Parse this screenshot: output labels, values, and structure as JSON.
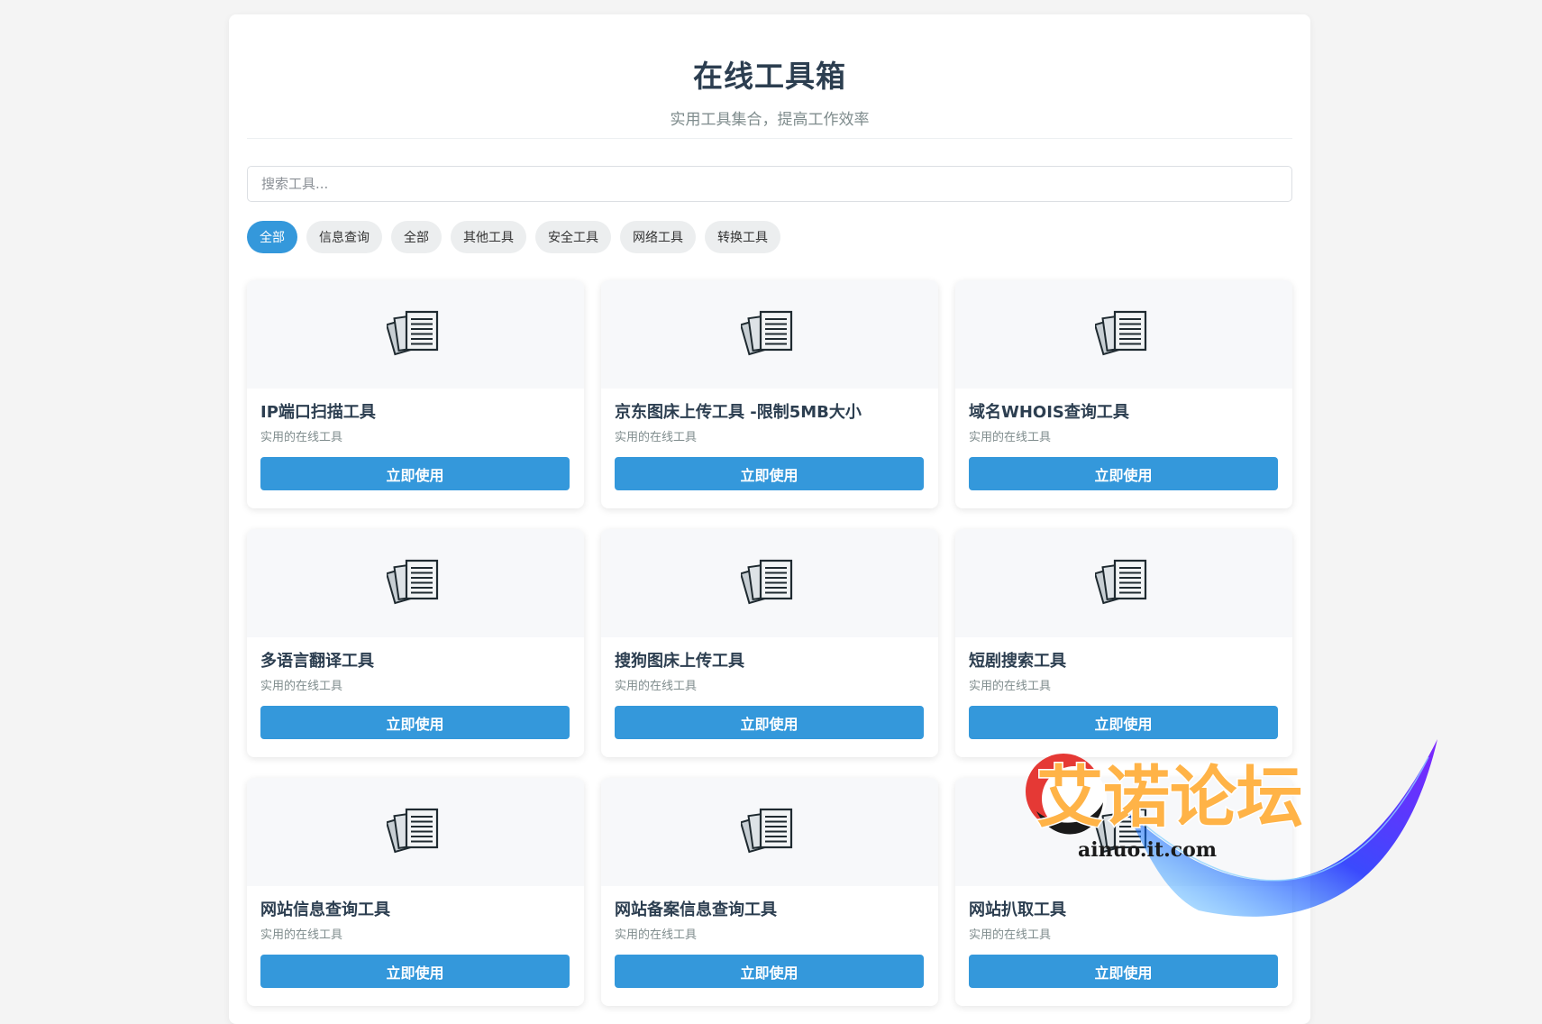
{
  "header": {
    "title": "在线工具箱",
    "subtitle": "实用工具集合，提高工作效率"
  },
  "search": {
    "placeholder": "搜索工具..."
  },
  "filters": [
    {
      "label": "全部",
      "active": true
    },
    {
      "label": "信息查询",
      "active": false
    },
    {
      "label": "全部",
      "active": false
    },
    {
      "label": "其他工具",
      "active": false
    },
    {
      "label": "安全工具",
      "active": false
    },
    {
      "label": "网络工具",
      "active": false
    },
    {
      "label": "转换工具",
      "active": false
    }
  ],
  "tools": [
    {
      "title": "IP端口扫描工具",
      "desc": "实用的在线工具",
      "button": "立即使用",
      "icon": "documents-icon"
    },
    {
      "title": "京东图床上传工具 -限制5MB大小",
      "desc": "实用的在线工具",
      "button": "立即使用",
      "icon": "documents-icon"
    },
    {
      "title": "域名WHOIS查询工具",
      "desc": "实用的在线工具",
      "button": "立即使用",
      "icon": "documents-icon"
    },
    {
      "title": "多语言翻译工具",
      "desc": "实用的在线工具",
      "button": "立即使用",
      "icon": "documents-icon"
    },
    {
      "title": "搜狗图床上传工具",
      "desc": "实用的在线工具",
      "button": "立即使用",
      "icon": "documents-icon"
    },
    {
      "title": "短剧搜索工具",
      "desc": "实用的在线工具",
      "button": "立即使用",
      "icon": "documents-icon"
    },
    {
      "title": "网站信息查询工具",
      "desc": "实用的在线工具",
      "button": "立即使用",
      "icon": "documents-icon"
    },
    {
      "title": "网站备案信息查询工具",
      "desc": "实用的在线工具",
      "button": "立即使用",
      "icon": "documents-icon"
    },
    {
      "title": "网站扒取工具",
      "desc": "实用的在线工具",
      "button": "立即使用",
      "icon": "documents-icon"
    }
  ],
  "watermark": {
    "text": "艾诺论坛",
    "url": "ainuo.it.com"
  },
  "colors": {
    "accent": "#3498db",
    "title": "#2c3e50",
    "muted": "#7f8c8d"
  }
}
